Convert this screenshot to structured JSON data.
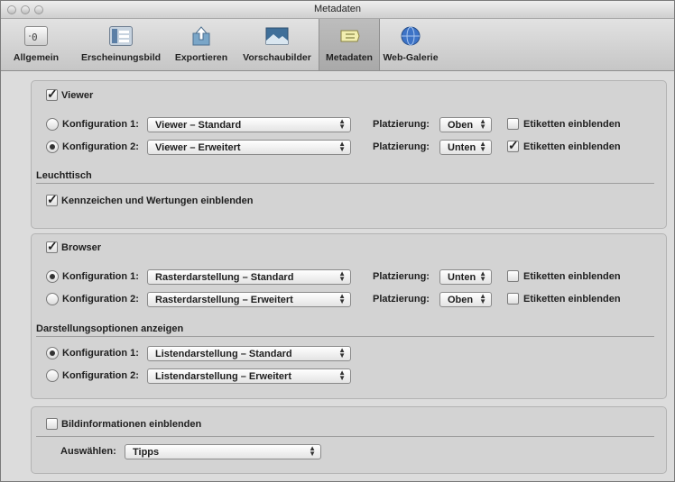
{
  "window": {
    "title": "Metadaten"
  },
  "toolbar": {
    "items": [
      {
        "label": "Allgemein",
        "icon": "general-settings-icon"
      },
      {
        "label": "Erscheinungsbild",
        "icon": "appearance-icon"
      },
      {
        "label": "Exportieren",
        "icon": "export-icon"
      },
      {
        "label": "Vorschaubilder",
        "icon": "previews-icon"
      },
      {
        "label": "Metadaten",
        "icon": "metadata-icon",
        "selected": true
      },
      {
        "label": "Web-Galerie",
        "icon": "web-gallery-icon"
      }
    ]
  },
  "viewer": {
    "checkbox_label": "Viewer",
    "checked": true,
    "rows": [
      {
        "config_label": "Konfiguration 1:",
        "selected": false,
        "preset": "Viewer – Standard",
        "placement_label": "Platzierung:",
        "placement": "Oben",
        "labels_label": "Etiketten einblenden",
        "labels_checked": false
      },
      {
        "config_label": "Konfiguration 2:",
        "selected": true,
        "preset": "Viewer – Erweitert",
        "placement_label": "Platzierung:",
        "placement": "Unten",
        "labels_label": "Etiketten einblenden",
        "labels_checked": true
      }
    ],
    "lighttable_heading": "Leuchttisch",
    "badges_label": "Kennzeichen und Wertungen einblenden",
    "badges_checked": true
  },
  "browser": {
    "checkbox_label": "Browser",
    "checked": true,
    "rows": [
      {
        "config_label": "Konfiguration 1:",
        "selected": true,
        "preset": "Rasterdarstellung – Standard",
        "placement_label": "Platzierung:",
        "placement": "Unten",
        "labels_label": "Etiketten einblenden",
        "labels_checked": false
      },
      {
        "config_label": "Konfiguration 2:",
        "selected": false,
        "preset": "Rasterdarstellung – Erweitert",
        "placement_label": "Platzierung:",
        "placement": "Oben",
        "labels_label": "Etiketten einblenden",
        "labels_checked": false
      }
    ],
    "display_heading": "Darstellungsoptionen anzeigen",
    "list_rows": [
      {
        "config_label": "Konfiguration 1:",
        "selected": true,
        "preset": "Listendarstellung – Standard"
      },
      {
        "config_label": "Konfiguration 2:",
        "selected": false,
        "preset": "Listendarstellung – Erweitert"
      }
    ]
  },
  "imageinfo": {
    "checkbox_label": "Bildinformationen einblenden",
    "checked": false,
    "select_label": "Auswählen:",
    "select_value": "Tipps"
  },
  "symbols": {
    "check": "✓",
    "select_arrows": "▲▼"
  },
  "colors": {
    "window_bg": "#e6e6e6",
    "panel_bg": "#d3d3d3",
    "toolbar_selected": "#b0b0b0"
  }
}
